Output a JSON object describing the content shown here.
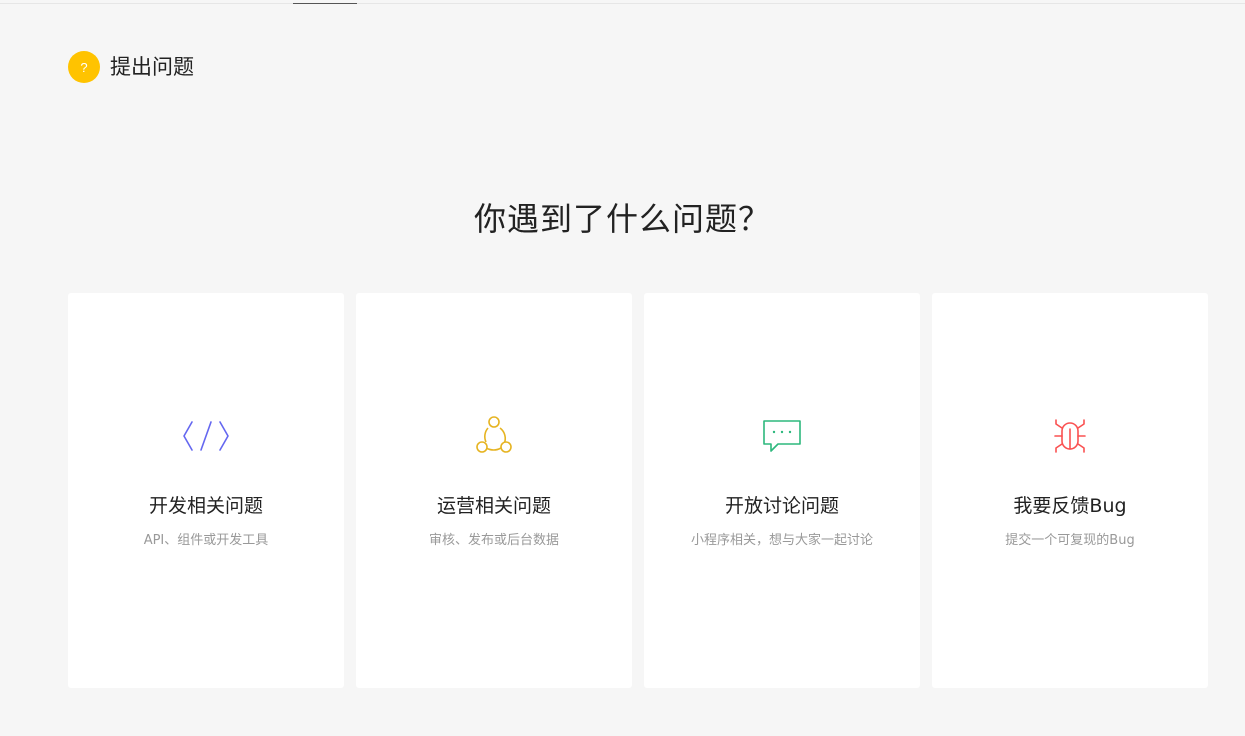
{
  "header": {
    "badge_text": "?",
    "title": "提出问题"
  },
  "question": "你遇到了什么问题？",
  "cards": [
    {
      "title": "开发相关问题",
      "description": "API、组件或开发工具",
      "icon": "code-icon",
      "color": "#6467f0"
    },
    {
      "title": "运营相关问题",
      "description": "审核、发布或后台数据",
      "icon": "share-nodes-icon",
      "color": "#e6b422"
    },
    {
      "title": "开放讨论问题",
      "description": "小程序相关，想与大家一起讨论",
      "icon": "chat-bubble-icon",
      "color": "#2db87d"
    },
    {
      "title": "我要反馈Bug",
      "description": "提交一个可复现的Bug",
      "icon": "bug-icon",
      "color": "#fa5151"
    }
  ],
  "colors": {
    "badge": "#ffc300",
    "background": "#f6f6f6"
  }
}
